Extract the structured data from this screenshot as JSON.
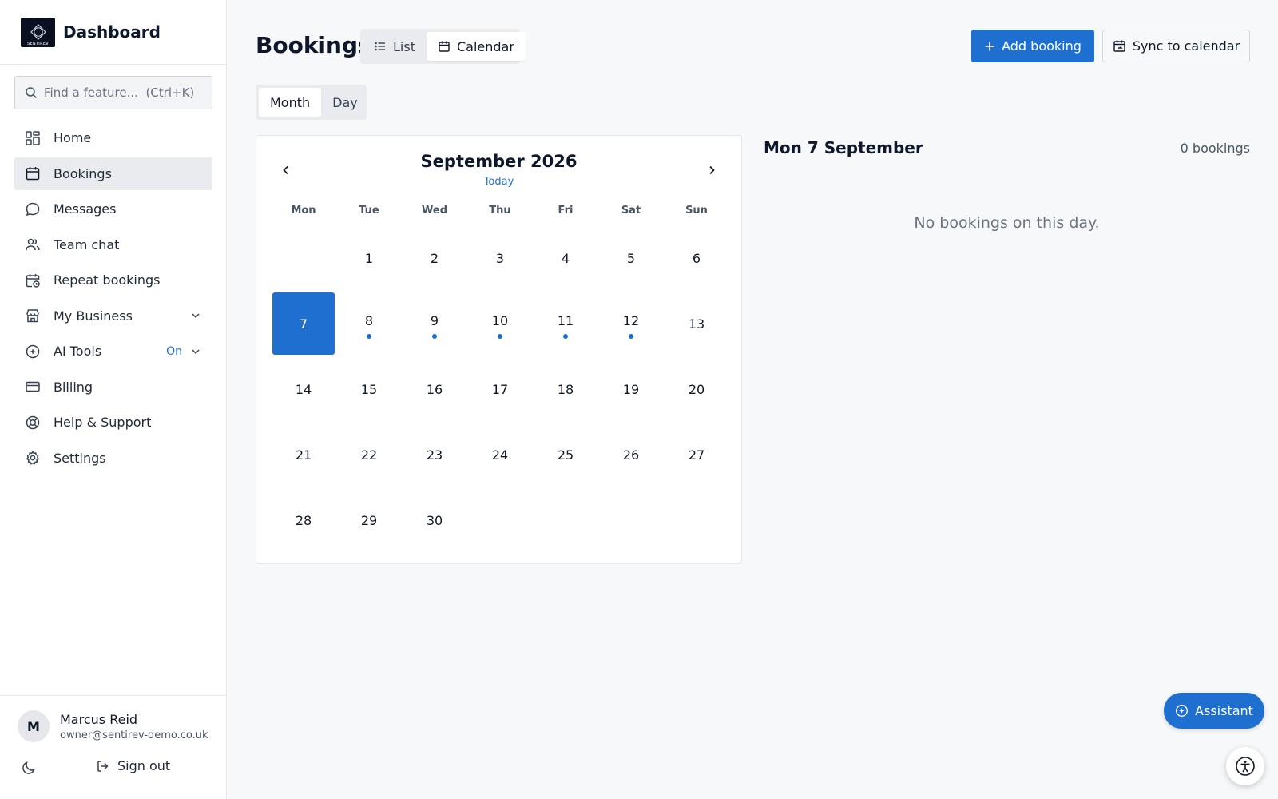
{
  "app": {
    "title": "Dashboard",
    "logo_text": "SENTIREV",
    "logo_letter": "S"
  },
  "search": {
    "placeholder": "Find a feature...  (Ctrl+K)"
  },
  "sidebar": {
    "items": [
      {
        "id": "home",
        "label": "Home",
        "icon": "grid-icon"
      },
      {
        "id": "bookings",
        "label": "Bookings",
        "icon": "calendar-icon",
        "active": true
      },
      {
        "id": "messages",
        "label": "Messages",
        "icon": "chat-bubble-icon"
      },
      {
        "id": "team-chat",
        "label": "Team chat",
        "icon": "users-icon"
      },
      {
        "id": "repeat-bookings",
        "label": "Repeat bookings",
        "icon": "calendar-clock-icon"
      },
      {
        "id": "my-business",
        "label": "My Business",
        "icon": "store-icon",
        "expandable": true
      },
      {
        "id": "ai-tools",
        "label": "AI Tools",
        "icon": "ai-icon",
        "expandable": true,
        "badge": "On"
      },
      {
        "id": "billing",
        "label": "Billing",
        "icon": "credit-card-icon"
      },
      {
        "id": "help",
        "label": "Help & Support",
        "icon": "lifebuoy-icon"
      },
      {
        "id": "settings",
        "label": "Settings",
        "icon": "gear-icon"
      }
    ]
  },
  "user": {
    "initial": "M",
    "name": "Marcus Reid",
    "email": "owner@sentirev-demo.co.uk",
    "sign_out": "Sign out"
  },
  "header": {
    "title": "Bookings",
    "view_list": "List",
    "view_calendar": "Calendar",
    "add_booking": "Add booking",
    "sync": "Sync to calendar"
  },
  "scope": {
    "month": "Month",
    "day": "Day"
  },
  "calendar": {
    "month_label": "September 2026",
    "today_label": "Today",
    "weekdays": [
      "Mon",
      "Tue",
      "Wed",
      "Thu",
      "Fri",
      "Sat",
      "Sun"
    ],
    "leading_blanks": 1,
    "days_in_month": 30,
    "selected_day": 7,
    "days_with_bookings": [
      8,
      9,
      10,
      11,
      12
    ]
  },
  "panel": {
    "date_label": "Mon 7 September",
    "count_label": "0 bookings",
    "empty_label": "No bookings on this day."
  },
  "assistant": {
    "label": "Assistant"
  },
  "colors": {
    "accent": "#1f6fd1"
  }
}
